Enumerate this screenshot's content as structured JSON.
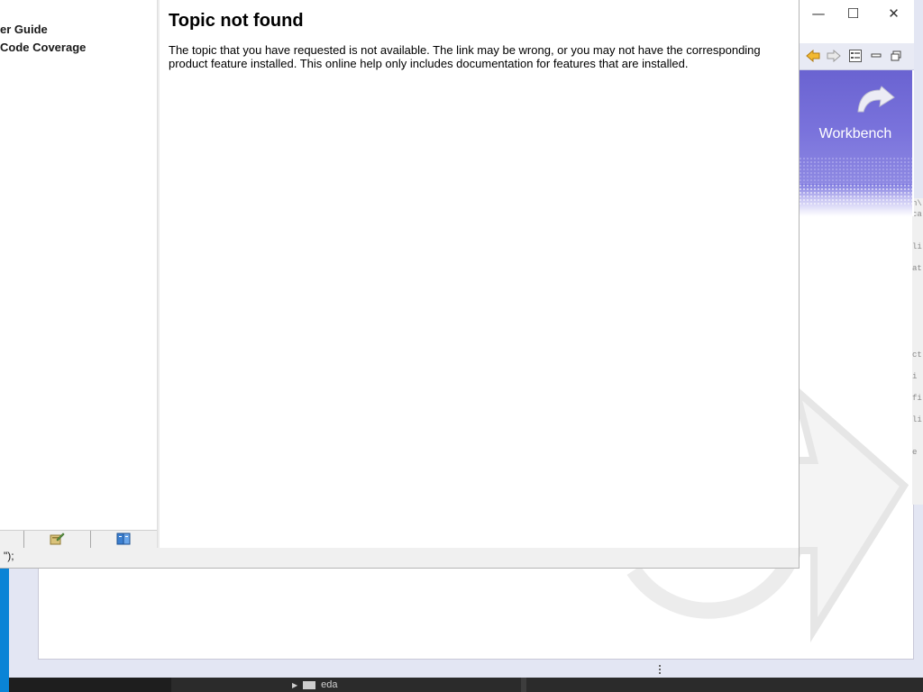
{
  "help_window": {
    "toc": {
      "items": [
        {
          "label": "er Guide"
        },
        {
          "label": "Code Coverage"
        }
      ],
      "tabs": [
        {
          "icon": "bookmark-edit-icon"
        },
        {
          "icon": "book-icon"
        }
      ]
    },
    "status_text": "\");",
    "content": {
      "title": "Topic not found",
      "body": "The topic that you have requested is not available. The link may be wrong, or you may not have the corresponding product feature installed. This online help only includes documentation for features that are installed."
    }
  },
  "welcome": {
    "window_controls": {
      "minimize": "—",
      "maximize": "☐",
      "close": "✕"
    },
    "toolbar_icons": [
      "back-arrow-icon",
      "forward-arrow-icon",
      "toc-icon",
      "minimize-view-icon",
      "restore-view-icon"
    ],
    "banner_title": "Workbench",
    "colors": {
      "banner": "#6a63d1",
      "back_arrow": "#e0a21c"
    }
  },
  "taskbar": {
    "item_label": "eda"
  },
  "editor_fragments": [
    "n\\",
    "ca",
    "",
    "",
    "li",
    "",
    "at",
    "",
    "",
    "",
    "",
    "",
    "",
    "",
    "ct",
    "",
    "i",
    "",
    "fi",
    "",
    "li",
    "",
    "",
    "e"
  ]
}
